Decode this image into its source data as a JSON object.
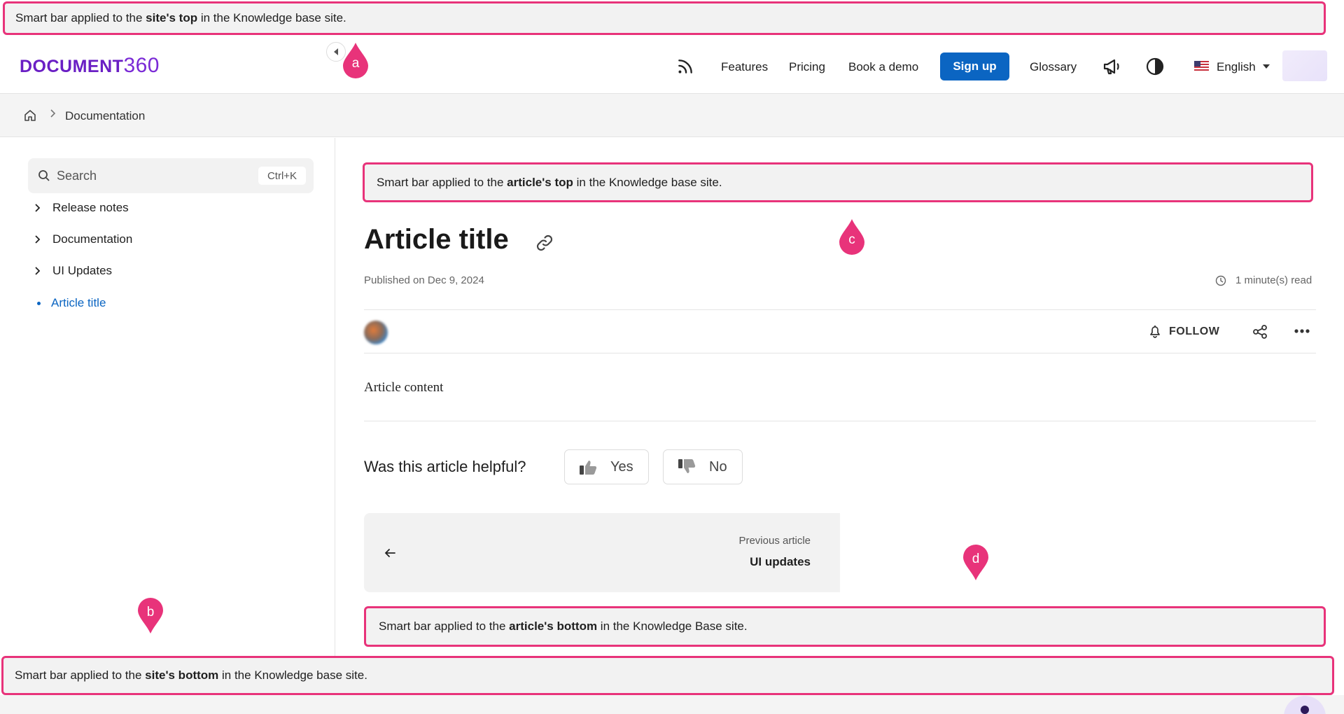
{
  "smart_bars": {
    "site_top": {
      "pre": "Smart bar applied to the ",
      "bold": "site's top",
      "post": " in the Knowledge base site."
    },
    "article_top": {
      "pre": "Smart bar applied to the ",
      "bold": "article's top",
      "post": " in the Knowledge base site."
    },
    "article_bottom": {
      "pre": "Smart bar applied to the ",
      "bold": "article's bottom",
      "post": " in the Knowledge Base site."
    },
    "site_bottom": {
      "pre": "Smart bar applied to the ",
      "bold": "site's bottom",
      "post": " in the Knowledge base site."
    }
  },
  "callouts": {
    "a": "a",
    "b": "b",
    "c": "c",
    "d": "d"
  },
  "colors": {
    "callout": "#e8337a",
    "accent": "#0b65c2",
    "logo": "#6a1fc4"
  },
  "header": {
    "logo_text": "DOCUMENT",
    "logo_num": "360",
    "nav": {
      "features": "Features",
      "pricing": "Pricing",
      "book_demo": "Book a demo",
      "signup": "Sign up",
      "glossary": "Glossary"
    },
    "language": "English",
    "icons": [
      "rss-icon",
      "megaphone-icon",
      "contrast-icon",
      "flag-icon"
    ]
  },
  "breadcrumb": {
    "items": [
      "Documentation"
    ]
  },
  "sidebar": {
    "search_placeholder": "Search",
    "search_shortcut": "Ctrl+K",
    "items": [
      {
        "label": "Release notes"
      },
      {
        "label": "Documentation"
      },
      {
        "label": "UI Updates"
      },
      {
        "label": "Article title",
        "active": true
      }
    ]
  },
  "article": {
    "title": "Article title",
    "published": "Published on Dec 9, 2024",
    "read_time": "1 minute(s) read",
    "follow": "FOLLOW",
    "content": "Article content",
    "feedback": {
      "question": "Was this article helpful?",
      "yes": "Yes",
      "no": "No"
    },
    "previous": {
      "label": "Previous article",
      "title": "UI updates"
    }
  }
}
